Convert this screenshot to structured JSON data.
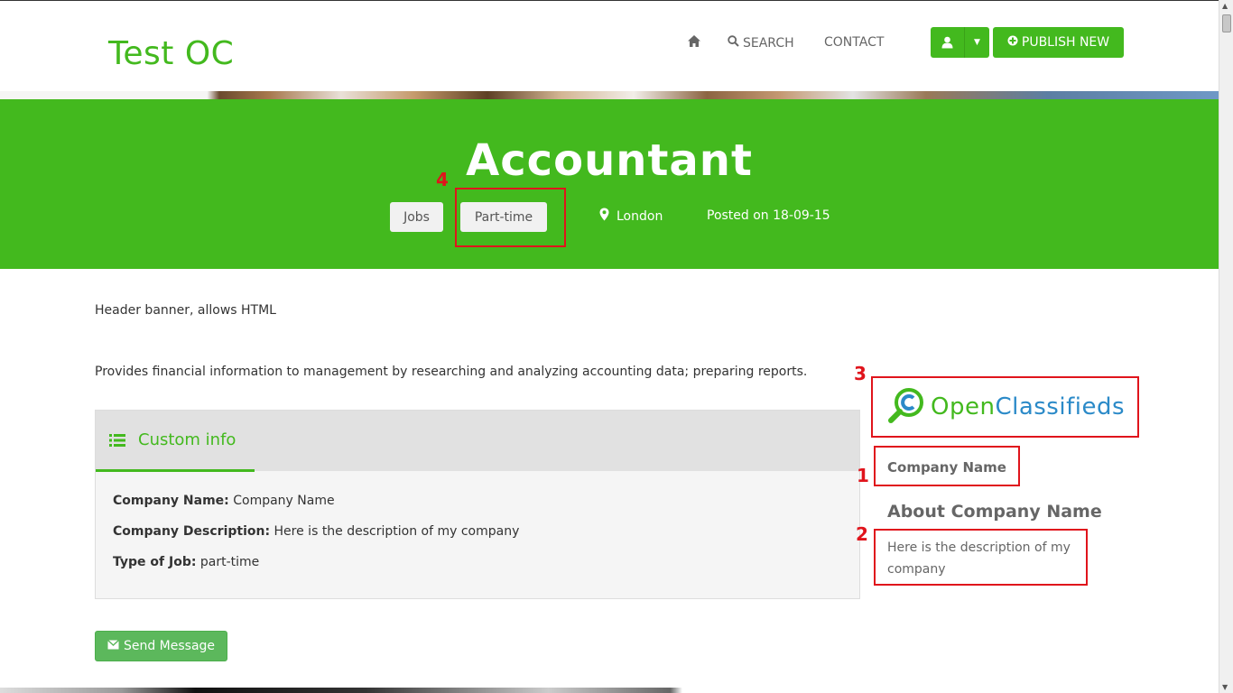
{
  "nav": {
    "brand": "Test OC",
    "search_label": "SEARCH",
    "contact_label": "CONTACT",
    "publish_label": "PUBLISH NEW"
  },
  "hero": {
    "title": "Accountant",
    "tags": [
      "Jobs",
      "Part-time"
    ],
    "location": "London",
    "posted": "Posted on 18-09-15"
  },
  "content": {
    "header_banner": "Header banner, allows HTML",
    "description": "Provides financial information to management by researching and analyzing accounting data; preparing reports.",
    "panel_title": "Custom info",
    "fields": [
      {
        "label": "Company Name",
        "value": "Company Name"
      },
      {
        "label": "Company Description",
        "value": "Here is the description of my company"
      },
      {
        "label": "Type of Job",
        "value": "part-time"
      }
    ],
    "send_label": "Send Message"
  },
  "sidebar": {
    "logo_open": "Open",
    "logo_classifieds": "Classifieds",
    "company_name": "Company Name",
    "about_title": "About Company Name",
    "about_desc": "Here is the description of my company"
  },
  "annotations": [
    "1",
    "2",
    "3",
    "4"
  ],
  "colors": {
    "brand_green": "#43b91e",
    "annotation_red": "#e0141c",
    "logo_blue": "#2b8ac8",
    "send_green": "#5cb85c"
  }
}
